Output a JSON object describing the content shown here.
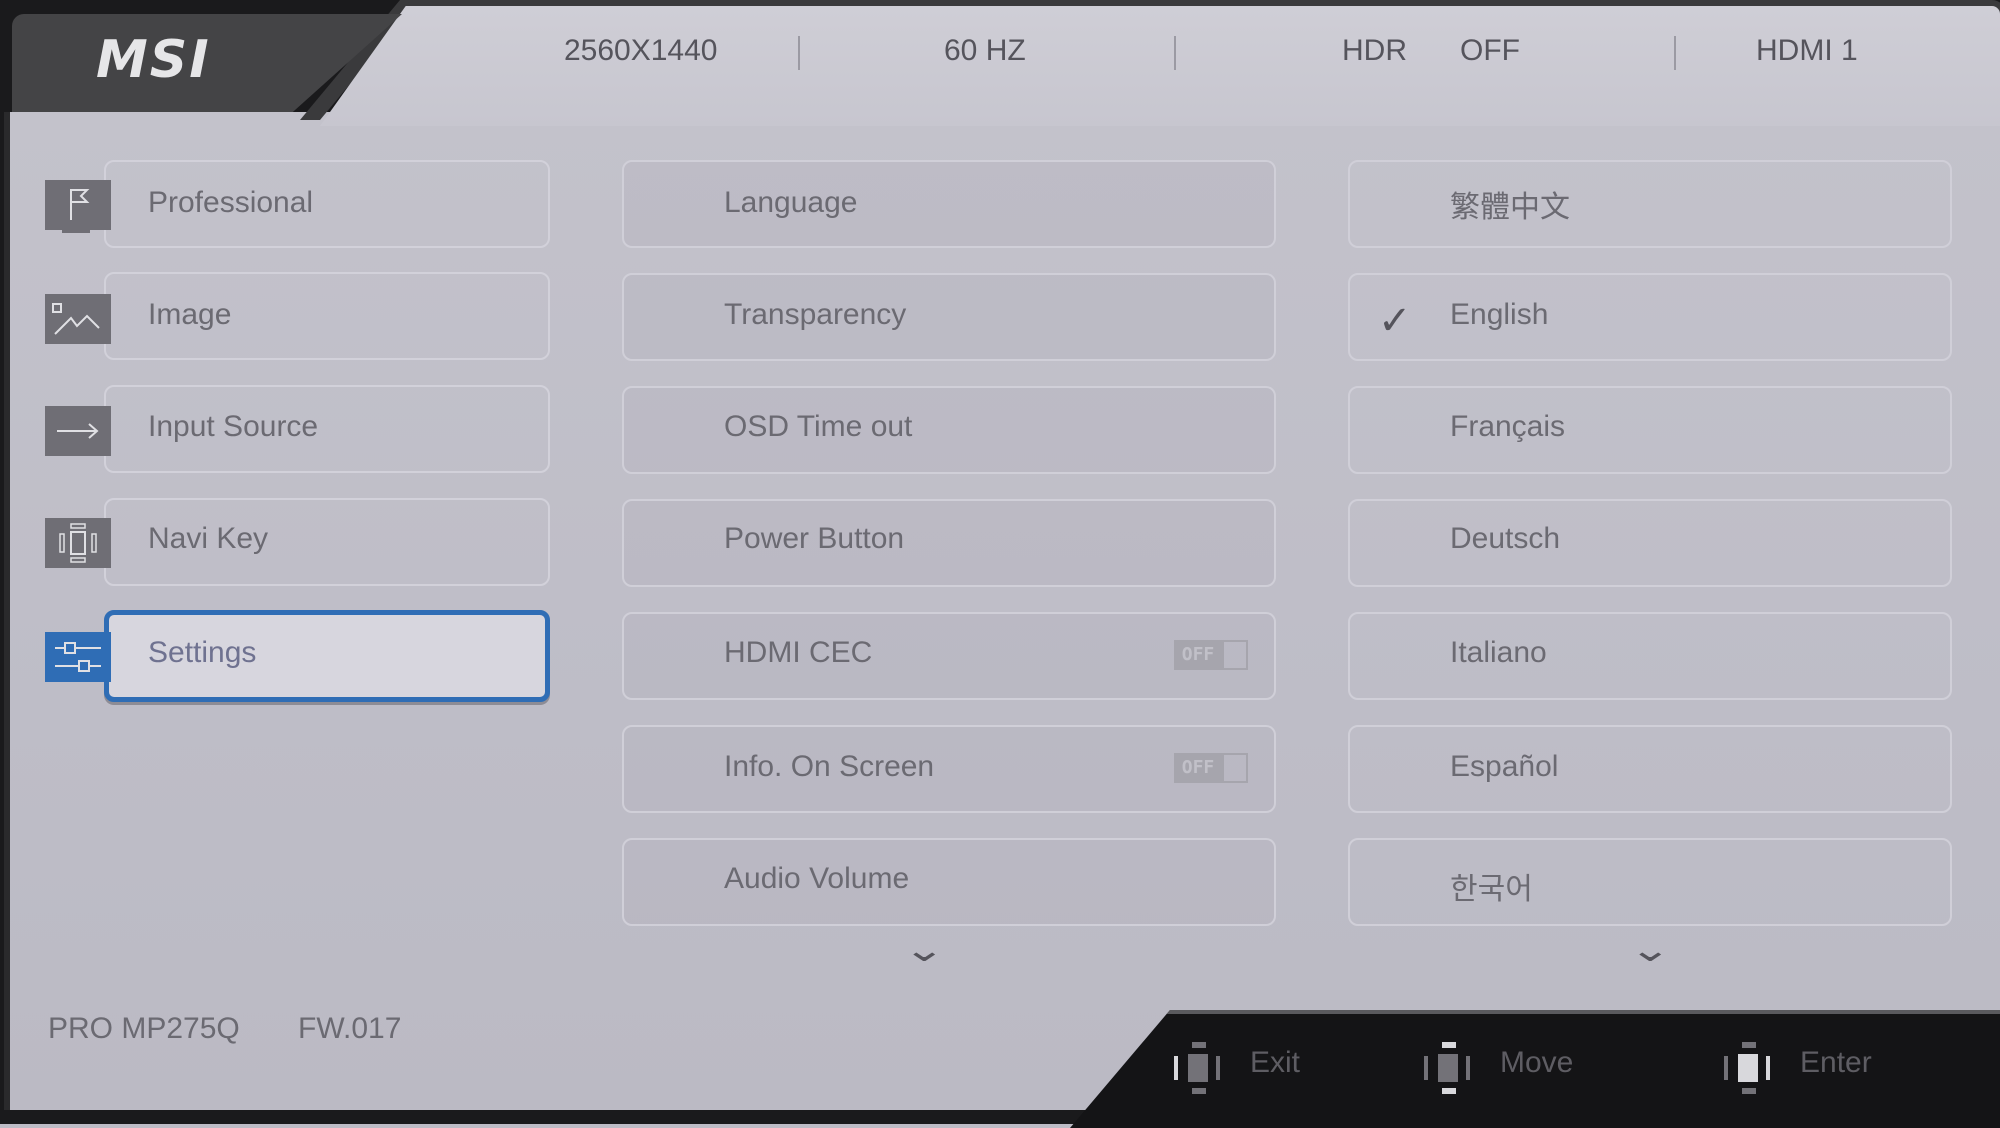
{
  "brand": {
    "logo": "MSI"
  },
  "status_bar": {
    "resolution": "2560X1440",
    "refresh_rate": "60 HZ",
    "hdr_label": "HDR",
    "hdr_value": "OFF",
    "input": "HDMI 1"
  },
  "sidebar": {
    "items": [
      {
        "label": "Professional",
        "icon": "flag-icon",
        "active": false
      },
      {
        "label": "Image",
        "icon": "image-icon",
        "active": false
      },
      {
        "label": "Input Source",
        "icon": "arrow-right-icon",
        "active": false
      },
      {
        "label": "Navi Key",
        "icon": "navi-key-icon",
        "active": false
      },
      {
        "label": "Settings",
        "icon": "sliders-icon",
        "active": true
      }
    ]
  },
  "settings": {
    "items": [
      {
        "label": "Language"
      },
      {
        "label": "Transparency"
      },
      {
        "label": "OSD Time out"
      },
      {
        "label": "Power Button"
      },
      {
        "label": "HDMI CEC",
        "toggle": "OFF"
      },
      {
        "label": "Info. On Screen",
        "toggle": "OFF"
      },
      {
        "label": "Audio Volume"
      }
    ],
    "more_icon": "chevron-down-icon"
  },
  "languages": {
    "items": [
      {
        "label": "繁體中文",
        "selected": false
      },
      {
        "label": "English",
        "selected": true
      },
      {
        "label": "Français",
        "selected": false
      },
      {
        "label": "Deutsch",
        "selected": false
      },
      {
        "label": "Italiano",
        "selected": false
      },
      {
        "label": "Español",
        "selected": false
      },
      {
        "label": "한국어",
        "selected": false
      }
    ],
    "more_icon": "chevron-down-icon"
  },
  "footer": {
    "model": "PRO MP275Q",
    "firmware": "FW.017",
    "hints": [
      {
        "label": "Exit",
        "icon": "navi-left-icon"
      },
      {
        "label": "Move",
        "icon": "navi-updown-icon"
      },
      {
        "label": "Enter",
        "icon": "navi-center-icon"
      }
    ]
  },
  "colors": {
    "accent": "#2f6db5",
    "panel": "#c3c2cb",
    "dark": "#141416"
  }
}
